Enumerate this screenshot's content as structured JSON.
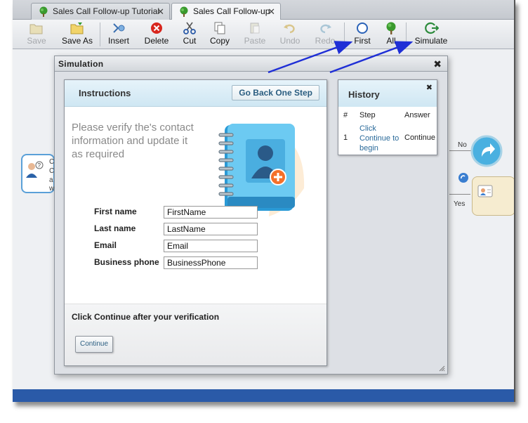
{
  "tabs": [
    {
      "label": "Sales Call Follow-up Tutorial",
      "icon": "tree-icon"
    },
    {
      "label": "Sales Call Follow-up",
      "icon": "tree-icon"
    }
  ],
  "toolbar": {
    "save": "Save",
    "save_as": "Save As",
    "insert": "Insert",
    "delete": "Delete",
    "cut": "Cut",
    "copy": "Copy",
    "paste": "Paste",
    "undo": "Undo",
    "redo": "Redo",
    "first": "First",
    "all": "All",
    "simulate": "Simulate"
  },
  "canvas": {
    "branch_no": "No",
    "branch_yes": "Yes",
    "node_text_fragment": [
      "C",
      "C",
      "a",
      "w"
    ]
  },
  "simulation": {
    "title": "Simulation",
    "close_glyph": "✖",
    "instructions": {
      "title": "Instructions",
      "go_back_label": "Go Back One Step",
      "text": "Please verify the's contact information and update it as required",
      "fields": [
        {
          "label": "First name",
          "value": "FirstName"
        },
        {
          "label": "Last name",
          "value": "LastName"
        },
        {
          "label": "Email",
          "value": "Email"
        },
        {
          "label": "Business phone",
          "value": "BusinessPhone"
        }
      ],
      "footer_text": "Click Continue after your verification",
      "continue_label": "Continue"
    },
    "history": {
      "title": "History",
      "close_glyph": "✖",
      "columns": [
        "#",
        "Step",
        "Answer"
      ],
      "rows": [
        {
          "num": "1",
          "step": "Click Continue to begin",
          "answer": "Continue"
        }
      ]
    }
  },
  "colors": {
    "arrow": "#1f2fd6",
    "header_gradient": "#cfe7f3",
    "link": "#2a6a9a"
  }
}
